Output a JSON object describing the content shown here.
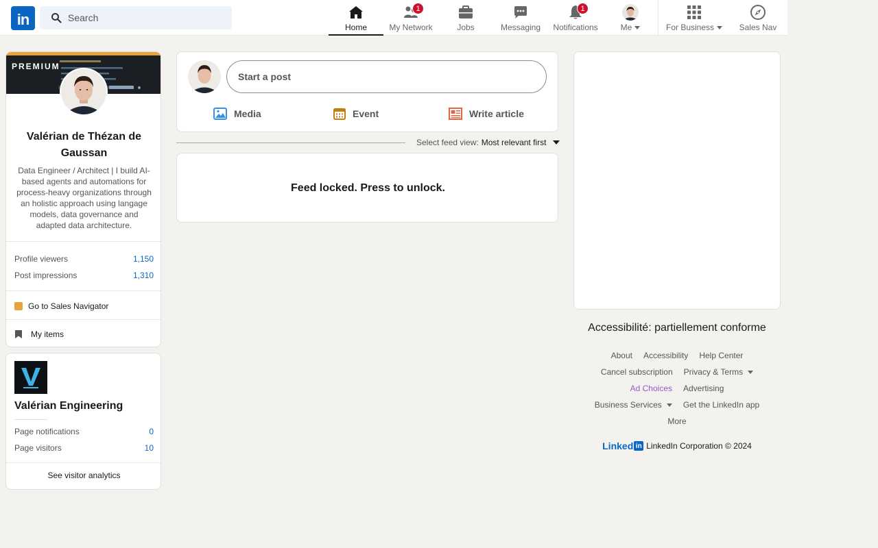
{
  "search": {
    "placeholder": "Search"
  },
  "nav": {
    "home": "Home",
    "network": "My Network",
    "network_badge": "1",
    "jobs": "Jobs",
    "messaging": "Messaging",
    "notifications": "Notifications",
    "notifications_badge": "1",
    "me": "Me",
    "business": "For Business",
    "salesnav": "Sales Nav"
  },
  "profile": {
    "premium_label": "PREMIUM",
    "name": "Valérian de Thézan de Gaussan",
    "headline": "Data Engineer / Architect | I build AI-based agents and automations for process-heavy organizations through an holistic approach using langage models, data governance and adapted data architecture.",
    "stats": [
      {
        "label": "Profile viewers",
        "value": "1,150"
      },
      {
        "label": "Post impressions",
        "value": "1,310"
      }
    ],
    "sales_nav_link": "Go to Sales Navigator",
    "my_items": "My items"
  },
  "company": {
    "name": "Valérian Engineering",
    "stats": [
      {
        "label": "Page notifications",
        "value": "0"
      },
      {
        "label": "Page visitors",
        "value": "10"
      }
    ],
    "analytics_link": "See visitor analytics"
  },
  "share": {
    "start_post": "Start a post",
    "media": "Media",
    "event": "Event",
    "article": "Write article"
  },
  "feed": {
    "sort_label": "Select feed view:",
    "sort_value": "Most relevant first",
    "locked_message": "Feed locked. Press to unlock."
  },
  "sidebar": {
    "accessibility": "Accessibilité: partiellement conforme"
  },
  "footer": {
    "about": "About",
    "accessibility": "Accessibility",
    "help": "Help Center",
    "cancel": "Cancel subscription",
    "privacy": "Privacy & Terms",
    "adchoices": "Ad Choices",
    "advertising": "Advertising",
    "business": "Business Services",
    "app": "Get the LinkedIn app",
    "more": "More",
    "copyright": "LinkedIn Corporation © 2024",
    "brand": "Linked",
    "brand_box": "in"
  },
  "colors": {
    "brand_blue": "#0a66c2",
    "badge_red": "#cb112d",
    "premium_gold": "#e7a33e",
    "page_bg": "#f4f2ee"
  }
}
